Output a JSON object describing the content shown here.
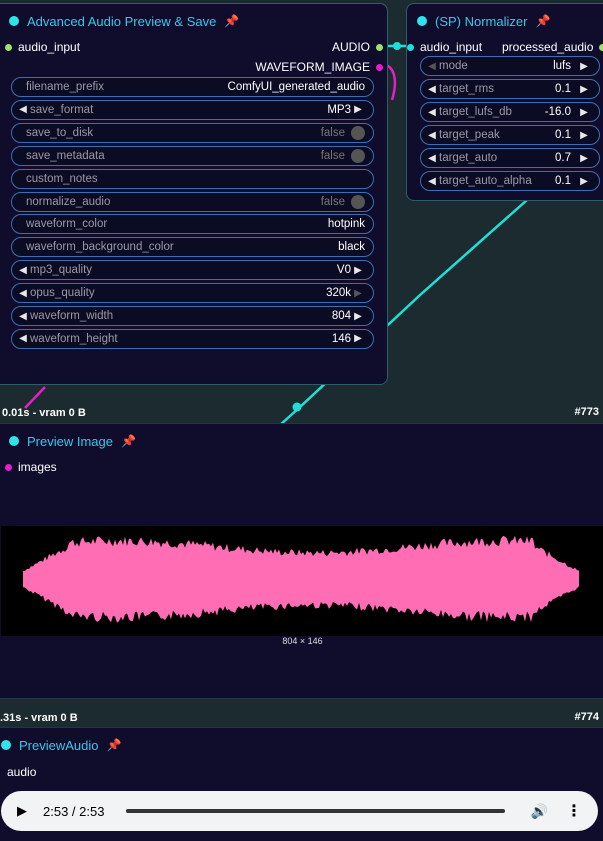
{
  "node_advanced": {
    "title": "Advanced Audio Preview & Save",
    "pin": "📌",
    "input_label": "audio_input",
    "output_audio": "AUDIO",
    "output_waveform": "WAVEFORM_IMAGE",
    "widgets": [
      {
        "label": "filename_prefix",
        "value": "ComfyUI_generated_audio",
        "kind": "text"
      },
      {
        "label": "save_format",
        "value": "MP3",
        "kind": "combo"
      },
      {
        "label": "save_to_disk",
        "value": "false",
        "kind": "toggle"
      },
      {
        "label": "save_metadata",
        "value": "false",
        "kind": "toggle"
      },
      {
        "label": "custom_notes",
        "value": "",
        "kind": "text"
      },
      {
        "label": "normalize_audio",
        "value": "false",
        "kind": "toggle"
      },
      {
        "label": "waveform_color",
        "value": "hotpink",
        "kind": "text"
      },
      {
        "label": "waveform_background_color",
        "value": "black",
        "kind": "text"
      },
      {
        "label": "mp3_quality",
        "value": "V0",
        "kind": "combo"
      },
      {
        "label": "opus_quality",
        "value": "320k",
        "kind": "combo"
      },
      {
        "label": "waveform_width",
        "value": "804",
        "kind": "combo"
      },
      {
        "label": "waveform_height",
        "value": "146",
        "kind": "combo"
      }
    ],
    "footer": "0.01s - vram 0 B",
    "id": "#773"
  },
  "node_normalizer": {
    "title": "(SP) Normalizer",
    "pin": "📌",
    "input_label": "audio_input",
    "output_label": "processed_audio",
    "widgets": [
      {
        "label": "mode",
        "value": "lufs"
      },
      {
        "label": "target_rms",
        "value": "0.1"
      },
      {
        "label": "target_lufs_db",
        "value": "-16.0"
      },
      {
        "label": "target_peak",
        "value": "0.1"
      },
      {
        "label": "target_auto",
        "value": "0.7"
      },
      {
        "label": "target_auto_alpha",
        "value": "0.1"
      }
    ]
  },
  "node_preview_image": {
    "title": "Preview Image",
    "pin": "📌",
    "input_label": "images",
    "image_size": "804 × 146",
    "footer": ".31s - vram 0 B",
    "id": "#774"
  },
  "node_preview_audio": {
    "title": "PreviewAudio",
    "pin": "📌",
    "input_label": "audio",
    "time": "2:53 / 2:53",
    "progress": 1.0
  },
  "colors": {
    "waveform": "#ff6eb4",
    "accent": "#35c9ec",
    "link_cyan": "#1fe0d8",
    "link_magenta": "#e41ec9"
  }
}
